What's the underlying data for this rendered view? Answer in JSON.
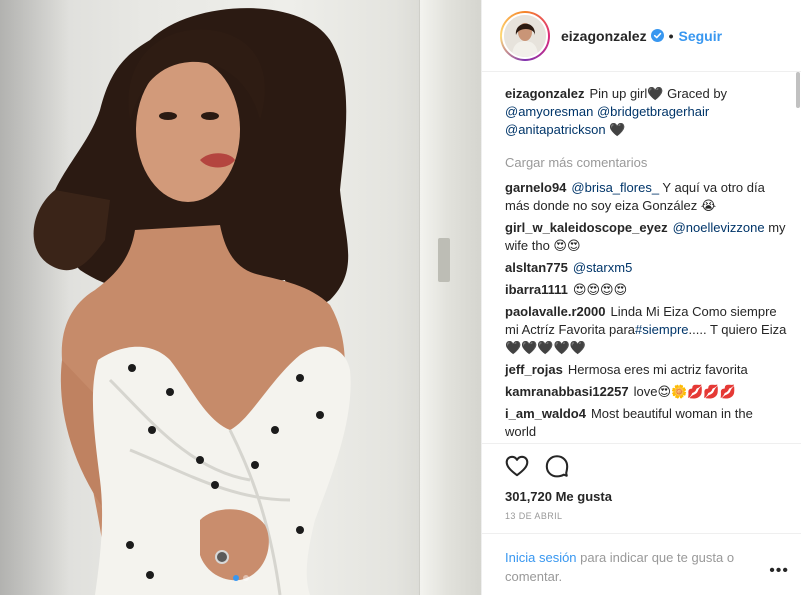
{
  "post": {
    "username": "eizagonzalez",
    "verified_icon": "verified-badge-icon",
    "separator": "•",
    "follow_label": "Seguir",
    "caption": {
      "user": "eizagonzalez",
      "text_1": "Pin up girl🖤 Graced by ",
      "mention_1": "@amyoresman",
      "text_2": " ",
      "mention_2": "@bridgetbragerhair",
      "text_3": " ",
      "mention_3": "@anitapatrickson",
      "text_4": " 🖤"
    },
    "load_more_label": "Cargar más comentarios",
    "comments": [
      {
        "user": "garnelo94",
        "mention": "@brisa_flores_",
        "text": " Y aquí va otro día más donde no soy eiza González 😭"
      },
      {
        "user": "girl_w_kaleidoscope_eyez",
        "mention": "@noellevizzone",
        "text": " my wife tho 😍😍"
      },
      {
        "user": "alsltan775",
        "mention": "@starxm5",
        "text": ""
      },
      {
        "user": "ibarra1111",
        "mention": "",
        "text": "😍😍😍😍"
      },
      {
        "user": "paolavalle.r2000",
        "mention": "",
        "text": "Linda Mi Eiza Como siempre mi Actríz Favorita para",
        "mention_after": "#siempre",
        "text_after": "..... T quiero Eiza 🖤🖤🖤🖤🖤"
      },
      {
        "user": "jeff_rojas",
        "mention": "",
        "text": "Hermosa eres mi actriz favorita"
      },
      {
        "user": "kamranabbasi12257",
        "mention": "",
        "text": "love😍🌼💋💋💋"
      },
      {
        "user": "i_am_waldo4",
        "mention": "",
        "text": "Most beautiful woman in the world"
      }
    ],
    "likes": "301,720 Me gusta",
    "date": "13 DE ABRIL",
    "login_link": "Inicia sesión",
    "login_text": " para indicar que te gusta o comentar.",
    "more_label": "•••",
    "icons": [
      "heart-icon",
      "comment-icon",
      "more-options-icon"
    ],
    "carousel": {
      "total": 2,
      "active": 1
    }
  },
  "colors": {
    "link": "#3897f0",
    "mention": "#003569",
    "muted": "#999999",
    "text": "#262626"
  }
}
